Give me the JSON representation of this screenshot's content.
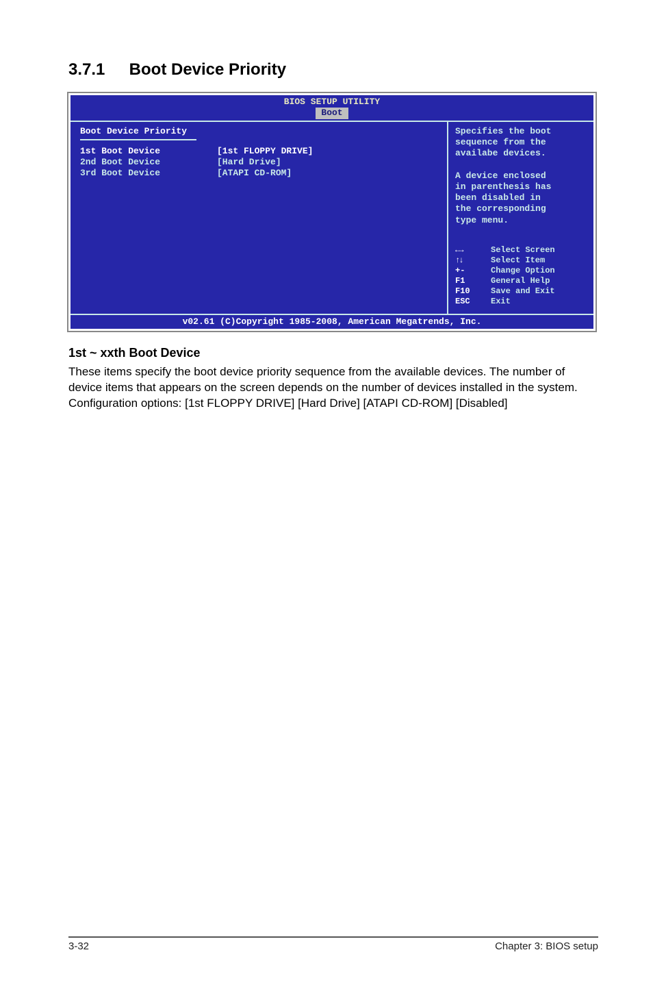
{
  "heading": {
    "number": "3.7.1",
    "title": "Boot Device Priority"
  },
  "bios": {
    "title": "BIOS SETUP UTILITY",
    "tab": "Boot",
    "panel_title": "Boot Device Priority",
    "items": [
      {
        "label": "1st Boot Device",
        "value": "[1st FLOPPY DRIVE]",
        "selected": true
      },
      {
        "label": "2nd Boot Device",
        "value": "[Hard Drive]",
        "selected": false
      },
      {
        "label": "3rd Boot Device",
        "value": "[ATAPI CD-ROM]",
        "selected": false
      }
    ],
    "help": {
      "l1": "Specifies the boot",
      "l2": "sequence from the",
      "l3": "availabe devices.",
      "l4": "A device enclosed",
      "l5": "in parenthesis has",
      "l6": "been disabled in",
      "l7": "the corresponding",
      "l8": "type menu."
    },
    "keys": {
      "k1": {
        "icon": "←→",
        "label": "Select Screen"
      },
      "k2": {
        "icon": "↑↓",
        "label": "Select Item"
      },
      "k3": {
        "key": "+-",
        "label": "Change Option"
      },
      "k4": {
        "key": "F1",
        "label": "General Help"
      },
      "k5": {
        "key": "F10",
        "label": "Save and Exit"
      },
      "k6": {
        "key": "ESC",
        "label": "Exit"
      }
    },
    "footer": "v02.61 (C)Copyright 1985-2008, American Megatrends, Inc."
  },
  "subheading": "1st ~ xxth Boot Device",
  "para1": "These items specify the boot device priority sequence from the available devices. The number of device items that appears on the screen depends on the number of devices installed in the system.",
  "para2": "Configuration options: [1st FLOPPY DRIVE] [Hard Drive] [ATAPI CD-ROM] [Disabled]",
  "footer": {
    "left": "3-32",
    "right": "Chapter 3: BIOS setup"
  }
}
